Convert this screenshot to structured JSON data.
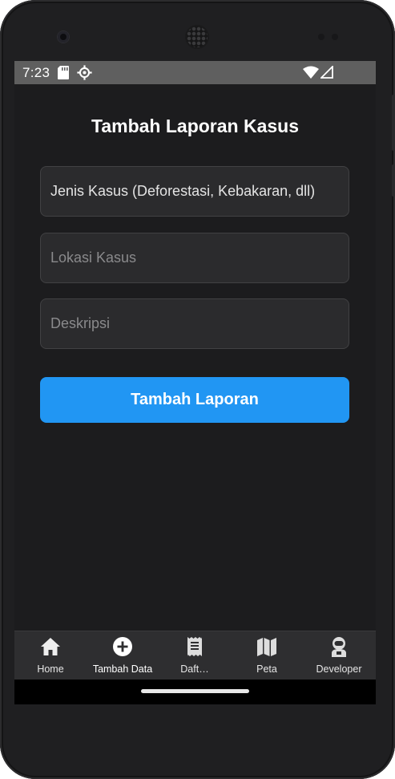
{
  "status_bar": {
    "time": "7:23",
    "icons": [
      "sd-card-icon",
      "settings-gear-icon",
      "wifi-icon",
      "cell-signal-icon"
    ]
  },
  "page": {
    "title": "Tambah Laporan Kasus"
  },
  "form": {
    "jenis_kasus": {
      "value": "Jenis Kasus (Deforestasi, Kebakaran, dll)",
      "placeholder": "Jenis Kasus (Deforestasi, Kebakaran, dll)"
    },
    "lokasi_kasus": {
      "value": "",
      "placeholder": "Lokasi Kasus"
    },
    "deskripsi": {
      "value": "",
      "placeholder": "Deskripsi"
    },
    "submit_label": "Tambah Laporan"
  },
  "bottom_nav": {
    "items": [
      {
        "label": "Home",
        "icon": "home-icon",
        "active": false
      },
      {
        "label": "Tambah Data",
        "icon": "add-circle-icon",
        "active": true
      },
      {
        "label": "Daft…",
        "icon": "receipt-list-icon",
        "active": false
      },
      {
        "label": "Peta",
        "icon": "map-icon",
        "active": false
      },
      {
        "label": "Developer",
        "icon": "astronaut-icon",
        "active": false
      }
    ]
  },
  "colors": {
    "background": "#1c1c1e",
    "field_background": "#2b2b2d",
    "accent": "#2196f3",
    "status_bar": "#5f5f5f",
    "nav_background": "#2e2e30"
  }
}
